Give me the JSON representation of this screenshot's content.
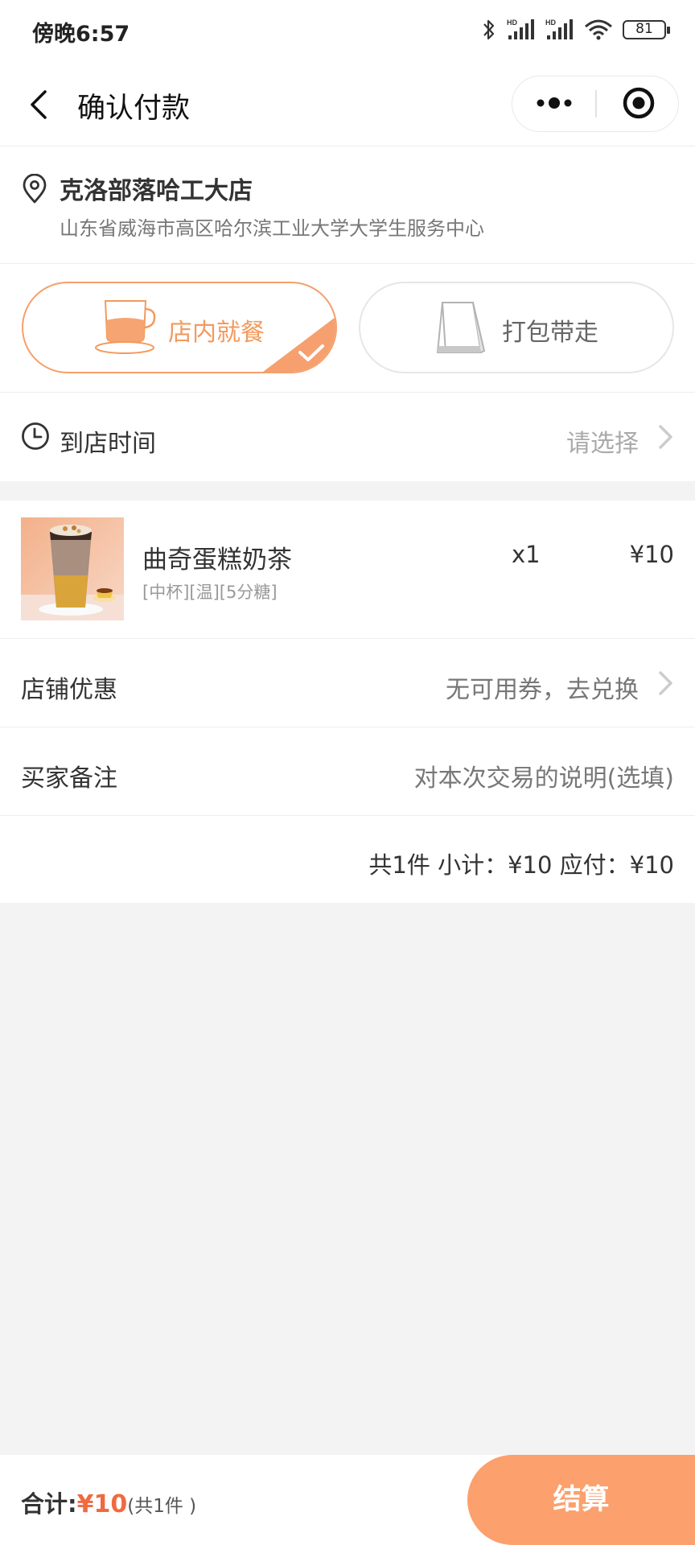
{
  "status_bar": {
    "time": "傍晚6:57",
    "battery": "81"
  },
  "nav": {
    "title": "确认付款"
  },
  "store": {
    "name": "克洛部落哈工大店",
    "address": "山东省威海市高区哈尔滨工业大学大学生服务中心"
  },
  "mode": {
    "dine_in": "店内就餐",
    "takeaway": "打包带走",
    "selected": "dine_in"
  },
  "arrival": {
    "label": "到店时间",
    "placeholder": "请选择"
  },
  "product": {
    "name": "曲奇蛋糕奶茶",
    "spec": "[中杯][温][5分糖]",
    "qty": "x1",
    "price": "¥10"
  },
  "coupon": {
    "label": "店铺优惠",
    "value": "无可用券，去兑换"
  },
  "note": {
    "label": "买家备注",
    "placeholder": "对本次交易的说明(选填)"
  },
  "summary": {
    "text": "共1件 小计：¥10 应付：¥10"
  },
  "footer": {
    "total_label": "合计:",
    "total_amount": "¥10",
    "total_count": "(共1件 )",
    "checkout": "结算"
  },
  "colors": {
    "accent": "#f29a5e",
    "checkout_bg": "#fca06d",
    "price_red": "#f06a40"
  }
}
